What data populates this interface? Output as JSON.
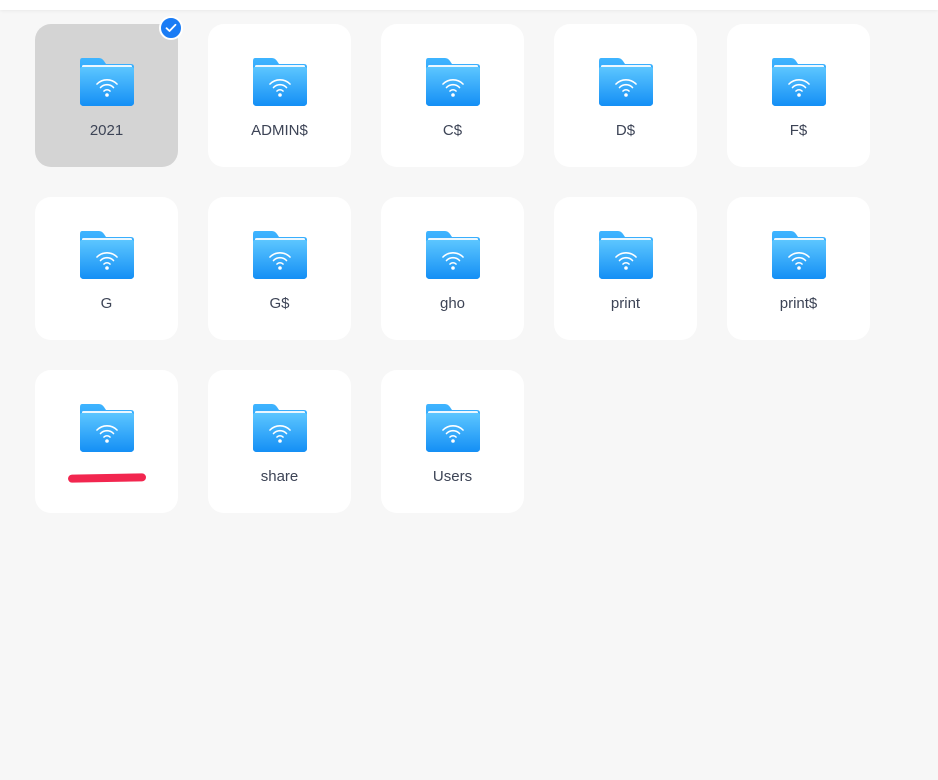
{
  "colors": {
    "background": "#f7f7f7",
    "tile": "#ffffff",
    "tile_selected": "#d4d4d4",
    "folder_light": "#5cc6ff",
    "folder_dark": "#148ff5",
    "check_badge": "#1a7cf5",
    "redaction": "#f2264f",
    "label": "#3d4456"
  },
  "folders": [
    {
      "label": "2021",
      "icon": "network-folder-icon",
      "selected": true
    },
    {
      "label": "ADMIN$",
      "icon": "network-folder-icon",
      "selected": false
    },
    {
      "label": "C$",
      "icon": "network-folder-icon",
      "selected": false
    },
    {
      "label": "D$",
      "icon": "network-folder-icon",
      "selected": false
    },
    {
      "label": "F$",
      "icon": "network-folder-icon",
      "selected": false
    },
    {
      "label": "G",
      "icon": "network-folder-icon",
      "selected": false
    },
    {
      "label": "G$",
      "icon": "network-folder-icon",
      "selected": false
    },
    {
      "label": "gho",
      "icon": "network-folder-icon",
      "selected": false
    },
    {
      "label": "print",
      "icon": "network-folder-icon",
      "selected": false
    },
    {
      "label": "print$",
      "icon": "network-folder-icon",
      "selected": false
    },
    {
      "label": "",
      "icon": "network-folder-icon",
      "selected": false,
      "redacted": true
    },
    {
      "label": "share",
      "icon": "network-folder-icon",
      "selected": false
    },
    {
      "label": "Users",
      "icon": "network-folder-icon",
      "selected": false
    }
  ]
}
